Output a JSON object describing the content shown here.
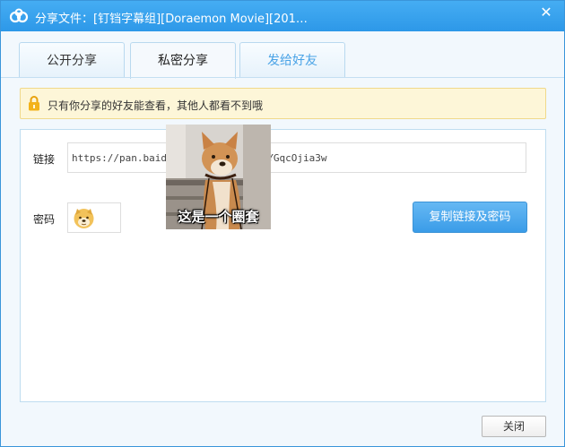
{
  "window": {
    "title": "分享文件：[钉铛字幕组][Doraemon Movie][201…"
  },
  "tabs": [
    {
      "label": "公开分享"
    },
    {
      "label": "私密分享"
    },
    {
      "label": "发给好友"
    }
  ],
  "notice": {
    "text": "只有你分享的好友能查看，其他人都看不到哦"
  },
  "form": {
    "link_label": "链接",
    "link_value_start": "https://pan.baidu.",
    "link_value_end": "YGqcOjia3w",
    "password_label": "密码",
    "copy_button_label": "复制链接及密码"
  },
  "meme": {
    "caption": "这是一个圈套"
  },
  "footer": {
    "close_label": "关闭"
  },
  "colors": {
    "title_bar": "#3aa3ee",
    "accent": "#4aa3e6",
    "notice_bg": "#fdf6d8"
  }
}
